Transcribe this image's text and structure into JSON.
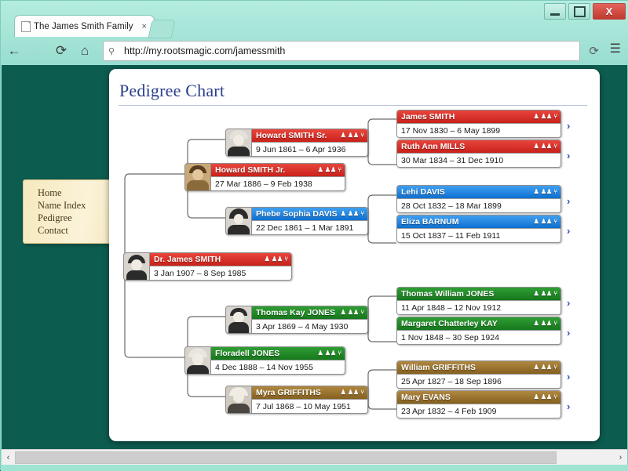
{
  "browser": {
    "tab_title": "The James Smith Family",
    "tab_close": "×",
    "url": "http://my.rootsmagic.com/jamessmith",
    "back_icon": "←",
    "forward_icon": "→",
    "reload_icon": "⟳",
    "home_icon": "⌂",
    "page_reload_icon": "⟳",
    "menu_icon": "☰",
    "search_icon": "⚲",
    "minimize_label": "",
    "maximize_label": "",
    "close_label": "X"
  },
  "sidebar": {
    "items": [
      {
        "label": "Home"
      },
      {
        "label": "Name Index"
      },
      {
        "label": "Pedigree"
      },
      {
        "label": "Contact"
      }
    ]
  },
  "page": {
    "title": "Pedigree Chart"
  },
  "icons": {
    "person": "♟",
    "family": "♟♟",
    "tree": "⑂",
    "expand_arrow": "›"
  },
  "colors": {
    "male": "#d42a20",
    "female": "#1479da",
    "green": "#1d8a22",
    "brown": "#8d6a2a",
    "accent_title": "#2b3f8c",
    "page_bg": "#0d5c50",
    "arrow": "#3b4fc0"
  },
  "chart_data": {
    "type": "pedigree",
    "title": "Pedigree Chart",
    "generations": 4,
    "people": [
      {
        "id": "p0",
        "gen": 0,
        "slot": "root",
        "name": "Dr. James SMITH",
        "dates": "3 Jan 1907 – 8 Sep 1985",
        "sex": "M",
        "theme": "male",
        "photo": true,
        "arrow": false
      },
      {
        "id": "p1",
        "gen": 1,
        "slot": "father",
        "name": "Howard SMITH Jr.",
        "dates": "27 Mar 1886 – 9 Feb 1938",
        "sex": "M",
        "theme": "male",
        "photo": true,
        "arrow": false
      },
      {
        "id": "p2",
        "gen": 1,
        "slot": "mother",
        "name": "Floradell JONES",
        "dates": "4 Dec 1888 – 14 Nov 1955",
        "sex": "F",
        "theme": "gmale",
        "photo": true,
        "arrow": false
      },
      {
        "id": "p3",
        "gen": 2,
        "slot": "ff",
        "name": "Howard SMITH Sr.",
        "dates": "9 Jun 1861 – 6 Apr 1936",
        "sex": "M",
        "theme": "male",
        "photo": true,
        "arrow": false
      },
      {
        "id": "p4",
        "gen": 2,
        "slot": "fm",
        "name": "Phebe Sophia DAVIS",
        "dates": "22 Dec 1861 – 1 Mar 1891",
        "sex": "F",
        "theme": "female",
        "photo": true,
        "arrow": false
      },
      {
        "id": "p5",
        "gen": 2,
        "slot": "mf",
        "name": "Thomas Kay JONES",
        "dates": "3 Apr 1869 – 4 May 1930",
        "sex": "M",
        "theme": "gmale",
        "photo": true,
        "arrow": false
      },
      {
        "id": "p6",
        "gen": 2,
        "slot": "mm",
        "name": "Myra GRIFFITHS",
        "dates": "7 Jul 1868 – 10 May 1951",
        "sex": "F",
        "theme": "gfem",
        "photo": true,
        "arrow": false
      },
      {
        "id": "p7",
        "gen": 3,
        "slot": "fff",
        "name": "James SMITH",
        "dates": "17 Nov 1830 – 6 May 1899",
        "sex": "M",
        "theme": "male",
        "photo": false,
        "arrow": true
      },
      {
        "id": "p8",
        "gen": 3,
        "slot": "ffm",
        "name": "Ruth Ann MILLS",
        "dates": "30 Mar 1834 – 31 Dec 1910",
        "sex": "F",
        "theme": "male",
        "photo": false,
        "arrow": true
      },
      {
        "id": "p9",
        "gen": 3,
        "slot": "fmf",
        "name": "Lehi DAVIS",
        "dates": "28 Oct 1832 – 18 Mar 1899",
        "sex": "M",
        "theme": "female",
        "photo": false,
        "arrow": true
      },
      {
        "id": "p10",
        "gen": 3,
        "slot": "fmm",
        "name": "Eliza BARNUM",
        "dates": "15 Oct 1837 – 11 Feb 1911",
        "sex": "F",
        "theme": "female",
        "photo": false,
        "arrow": true
      },
      {
        "id": "p11",
        "gen": 3,
        "slot": "mff",
        "name": "Thomas William JONES",
        "dates": "11 Apr 1848 – 12 Nov 1912",
        "sex": "M",
        "theme": "gmale",
        "photo": false,
        "arrow": true
      },
      {
        "id": "p12",
        "gen": 3,
        "slot": "mfm",
        "name": "Margaret Chatterley KAY",
        "dates": "1 Nov 1848 – 30 Sep 1924",
        "sex": "F",
        "theme": "gmale",
        "photo": false,
        "arrow": true
      },
      {
        "id": "p13",
        "gen": 3,
        "slot": "mmf",
        "name": "William GRIFFITHS",
        "dates": "25 Apr 1827 – 18 Sep 1896",
        "sex": "M",
        "theme": "gfem",
        "photo": false,
        "arrow": true
      },
      {
        "id": "p14",
        "gen": 3,
        "slot": "mmm",
        "name": "Mary EVANS",
        "dates": "23 Apr 1832 – 4 Feb 1909",
        "sex": "F",
        "theme": "gfem",
        "photo": false,
        "arrow": true
      }
    ]
  },
  "scrollbar": {
    "left_arrow": "‹",
    "right_arrow": "›"
  }
}
